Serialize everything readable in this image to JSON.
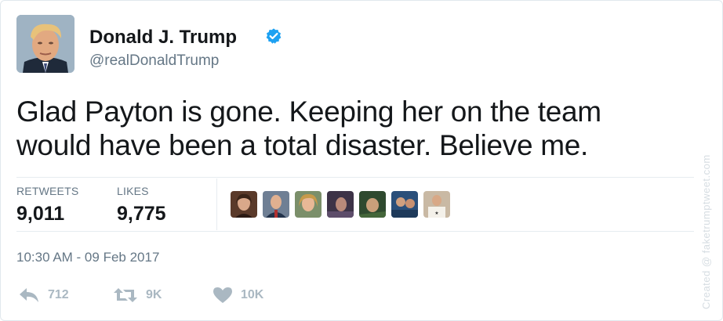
{
  "author": {
    "name": "Donald J. Trump",
    "handle": "@realDonaldTrump",
    "verified": true
  },
  "tweet": {
    "lines": [
      "Glad Payton is gone. Keeping her on the team",
      "would have been a total disaster. Believe me."
    ]
  },
  "stats": {
    "retweets_label": "RETWEETS",
    "retweets_value": "9,011",
    "likes_label": "LIKES",
    "likes_value": "9,775"
  },
  "liker_avatars": [
    "avatar-1",
    "avatar-2",
    "avatar-3",
    "avatar-4",
    "avatar-5",
    "avatar-6",
    "avatar-7"
  ],
  "timestamp": "10:30 AM - 09 Feb 2017",
  "actions": {
    "reply_count": "712",
    "retweet_count": "9K",
    "like_count": "10K"
  },
  "watermark": "Created @ faketrumptweet.com",
  "colors": {
    "verified_blue": "#1da1f2",
    "secondary_text": "#657786",
    "action_gray": "#aab8c2"
  }
}
